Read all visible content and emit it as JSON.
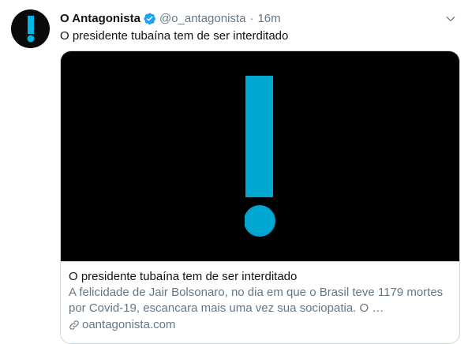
{
  "author": {
    "display_name": "O Antagonista",
    "handle": "@o_antagonista",
    "separator": "·",
    "timestamp": "16m",
    "verified": true
  },
  "tweet": {
    "text": "O presidente tubaína tem de ser interditado"
  },
  "card": {
    "title": "O presidente tubaína tem de ser interditado",
    "description": "A felicidade de Jair Bolsonaro, no dia em que o Brasil teve 1179 mortes por Covid-19, escancara mais uma vez sua sociopatia. O …",
    "domain": "oantagonista.com"
  },
  "colors": {
    "brand_cyan": "#00a7d0",
    "verified_blue": "#1da1f2",
    "secondary_text": "#657786"
  },
  "icons": {
    "avatar": "exclamation-logo",
    "verified": "verified-badge-icon",
    "caret": "chevron-down-icon",
    "link": "link-icon"
  }
}
